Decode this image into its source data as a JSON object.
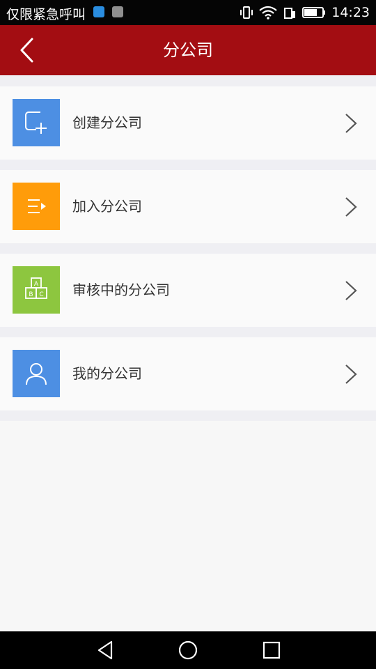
{
  "status_bar": {
    "left_text": "仅限紧急呼叫",
    "time": "14:23"
  },
  "app_bar": {
    "title": "分公司"
  },
  "menu": {
    "items": [
      {
        "label": "创建分公司",
        "icon": "add-square-icon",
        "color": "#4d8fe3"
      },
      {
        "label": "加入分公司",
        "icon": "list-join-icon",
        "color": "#ff9c0a"
      },
      {
        "label": "审核中的分公司",
        "icon": "abc-blocks-icon",
        "color": "#8dc63f"
      },
      {
        "label": "我的分公司",
        "icon": "person-icon",
        "color": "#4d8fe3"
      }
    ]
  },
  "colors": {
    "app_bar": "#a30d12",
    "background": "#f7f7f7"
  }
}
